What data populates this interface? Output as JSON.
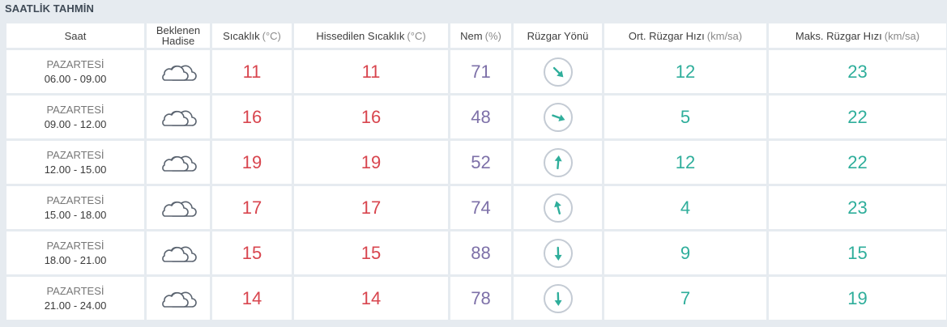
{
  "title": "SAATLİK TAHMİN",
  "headers": {
    "saat": "Saat",
    "hadise_1": "Beklenen",
    "hadise_2": "Hadise",
    "sicaklik": "Sıcaklık",
    "sicaklik_unit": "(°C)",
    "hissedilen": "Hissedilen Sıcaklık",
    "hissedilen_unit": "(°C)",
    "nem": "Nem",
    "nem_unit": "(%)",
    "ruzgar_yonu": "Rüzgar Yönü",
    "ort_ruzgar": "Ort. Rüzgar Hızı",
    "ort_ruzgar_unit": "(km/sa)",
    "maks_ruzgar": "Maks. Rüzgar Hızı",
    "maks_ruzgar_unit": "(km/sa)"
  },
  "colors": {
    "temperature": "#d8454e",
    "humidity": "#7d70a8",
    "wind": "#2fae9b",
    "cloud_stroke": "#5b6470"
  },
  "rows": [
    {
      "day": "PAZARTESİ",
      "range": "06.00 - 09.00",
      "icon": "cloud-icon",
      "temp": "11",
      "feels": "11",
      "humidity": "71",
      "wind_dir_deg": 135,
      "wind_avg": "12",
      "wind_max": "23"
    },
    {
      "day": "PAZARTESİ",
      "range": "09.00 - 12.00",
      "icon": "cloud-icon",
      "temp": "16",
      "feels": "16",
      "humidity": "48",
      "wind_dir_deg": 110,
      "wind_avg": "5",
      "wind_max": "22"
    },
    {
      "day": "PAZARTESİ",
      "range": "12.00 - 15.00",
      "icon": "cloud-icon",
      "temp": "19",
      "feels": "19",
      "humidity": "52",
      "wind_dir_deg": 5,
      "wind_avg": "12",
      "wind_max": "22"
    },
    {
      "day": "PAZARTESİ",
      "range": "15.00 - 18.00",
      "icon": "cloud-icon",
      "temp": "17",
      "feels": "17",
      "humidity": "74",
      "wind_dir_deg": -15,
      "wind_avg": "4",
      "wind_max": "23"
    },
    {
      "day": "PAZARTESİ",
      "range": "18.00 - 21.00",
      "icon": "cloud-icon",
      "temp": "15",
      "feels": "15",
      "humidity": "88",
      "wind_dir_deg": 178,
      "wind_avg": "9",
      "wind_max": "15"
    },
    {
      "day": "PAZARTESİ",
      "range": "21.00 - 24.00",
      "icon": "cloud-icon",
      "temp": "14",
      "feels": "14",
      "humidity": "78",
      "wind_dir_deg": 178,
      "wind_avg": "7",
      "wind_max": "19"
    }
  ]
}
